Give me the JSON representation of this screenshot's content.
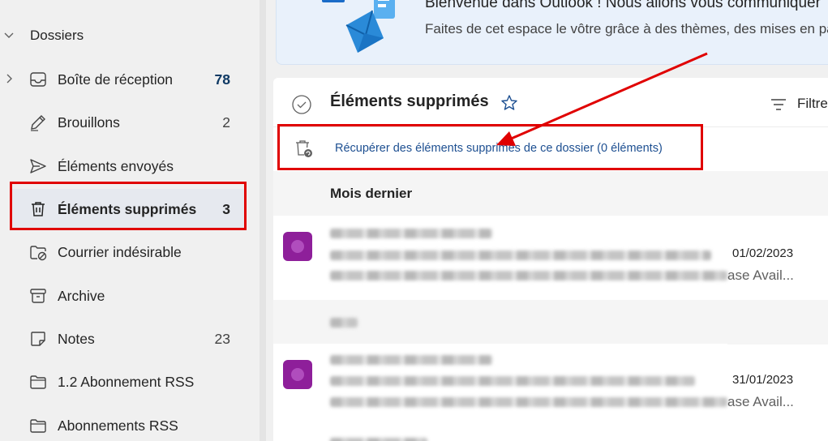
{
  "sidebar": {
    "folders_header": "Dossiers",
    "items": [
      {
        "label": "Boîte de réception",
        "count": "78",
        "icon": "inbox-icon"
      },
      {
        "label": "Brouillons",
        "count": "2",
        "icon": "pencil-icon"
      },
      {
        "label": "Éléments envoyés",
        "count": "",
        "icon": "send-icon"
      },
      {
        "label": "Éléments supprimés",
        "count": "3",
        "icon": "trash-icon"
      },
      {
        "label": "Courrier indésirable",
        "count": "",
        "icon": "junk-icon"
      },
      {
        "label": "Archive",
        "count": "",
        "icon": "archive-icon"
      },
      {
        "label": "Notes",
        "count": "23",
        "icon": "notes-icon"
      },
      {
        "label": "1.2 Abonnement RSS",
        "count": "",
        "icon": "folder-icon"
      },
      {
        "label": "Abonnements RSS",
        "count": "",
        "icon": "folder-icon"
      }
    ]
  },
  "banner": {
    "title": "Bienvenue dans Outlook ! Nous allons vous communiquer",
    "subtitle": "Faites de cet espace le vôtre grâce à des thèmes, des mises en page"
  },
  "list": {
    "title": "Éléments supprimés",
    "filter_label": "Filtre",
    "recover_link": "Récupérer des éléments supprimés de ce dossier (0 éléments)",
    "group_label": "Mois dernier",
    "messages": [
      {
        "date": "01/02/2023",
        "preview_tail": "ase Avail..."
      },
      {
        "date": "31/01/2023",
        "preview_tail": "ase Avail..."
      }
    ]
  },
  "colors": {
    "annotation_red": "#e00000",
    "link_blue": "#1d4f91",
    "avatar_purple": "#8e1f9a"
  }
}
